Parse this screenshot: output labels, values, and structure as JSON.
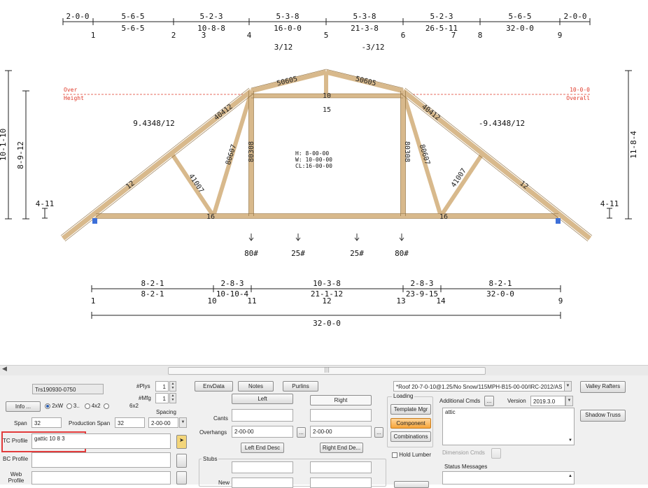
{
  "top_dims": {
    "segments": [
      "2-0-0",
      "5-6-5",
      "5-2-3",
      "5-3-8",
      "5-3-8",
      "5-2-3",
      "5-6-5",
      "2-0-0"
    ],
    "cumulative": [
      "5-6-5",
      "10-8-8",
      "16-0-0",
      "21-3-8",
      "26-5-11",
      "32-0-0"
    ],
    "panel_points": [
      "1",
      "2",
      "3",
      "4",
      "5",
      "6",
      "7",
      "8",
      "9"
    ],
    "pitch_left": "3/12",
    "pitch_right": "-3/12"
  },
  "heights": {
    "overall_left": "10-1-10",
    "inner_left": "8-9-12",
    "overall_right": "11-8-4",
    "heel_left": "4-11",
    "heel_right": "4-11",
    "over_label": "Over",
    "height_label": "Height",
    "over_value": "10-0-0",
    "overall_label": "Overall"
  },
  "slopes": {
    "left": "9.4348/12",
    "right": "-9.4348/12"
  },
  "members": {
    "top_left": "50605",
    "top_right": "50605",
    "slope_left": "40412",
    "slope_right": "40412",
    "web_left": "80607",
    "web_right": "80607",
    "vert_left": "80308",
    "vert_right": "80308",
    "diag_left": "41007",
    "diag_right": "41007",
    "chord_left": "12",
    "chord_right": "12",
    "bottom_left": "16",
    "bottom_right": "16",
    "apex": "10",
    "ceiling": "15"
  },
  "room": {
    "h": "H:  8-00-00",
    "w": "W: 10-00-00",
    "cl": "CL:16-00-00"
  },
  "loads": [
    "80#",
    "25#",
    "25#",
    "80#"
  ],
  "bottom_dims": {
    "segments": [
      "8-2-1",
      "2-8-3",
      "10-3-8",
      "2-8-3",
      "8-2-1"
    ],
    "cumulative": [
      "8-2-1",
      "10-10-4",
      "21-1-12",
      "23-9-15",
      "32-0-0"
    ],
    "points": [
      "1",
      "10",
      "11",
      "12",
      "13",
      "14",
      "9"
    ],
    "overall": "32-0-0"
  },
  "form": {
    "truss_name": "Trs190930-0750",
    "plys_label": "#Plys",
    "plys_value": "1",
    "mfg_label": "#Mfg",
    "mfg_value": "1",
    "info_button": "Info ...",
    "lumber_options": [
      "2xW",
      "3..",
      "4x2",
      "6x2"
    ],
    "lumber_selected": "2xW",
    "spacing_label": "Spacing",
    "spacing_value": "2-00-00",
    "span_label": "Span",
    "span_value": "32",
    "production_span_label": "Production Span",
    "production_span_value": "32",
    "tc_profile_label": "TC Profile",
    "tc_profile_value": "gattic 10 8 3",
    "bc_profile_label": "BC Profile",
    "bc_profile_value": "",
    "web_profile_label": "Web Profile",
    "envdata_button": "EnvData",
    "notes_button": "Notes",
    "purlins_button": "Purlins",
    "left_tab": "Left",
    "right_tab": "Right",
    "cants_label": "Cants",
    "overhangs_label": "Overhangs",
    "overhang_left": "2-00-00",
    "overhang_right": "2-00-00",
    "left_end_desc": "Left End Desc",
    "right_end_desc": "Right End De...",
    "stubs_label": "Stubs",
    "new_label": "New",
    "roof_desc": "*Roof 20-7-0-10@1.25/No Snow/115MPH-B15-00-00/IRC-2012/AS",
    "valley_rafters_button": "Valley Rafters",
    "loading_label": "Loading",
    "template_mgr_button": "Template Mgr",
    "component_button": "Component",
    "combinations_button": "Combinations",
    "hold_lumber_label": "Hold Lumber",
    "additional_cmds_label": "Additional Cmds",
    "version_label": "Version",
    "version_value": "2019.3.0",
    "cmds_text": "attic",
    "shadow_truss_button": "Shadow Truss",
    "dimension_cmds_label": "Dimension Cmds",
    "status_messages_label": "Status Messages"
  },
  "colors": {
    "lumber": "#d8b98c",
    "lumber_edge": "#8a6a3a",
    "dim_line": "#222222",
    "over_height": "#e03a2a",
    "highlight": "#e23b3b",
    "component_button": "#f7a53a"
  }
}
